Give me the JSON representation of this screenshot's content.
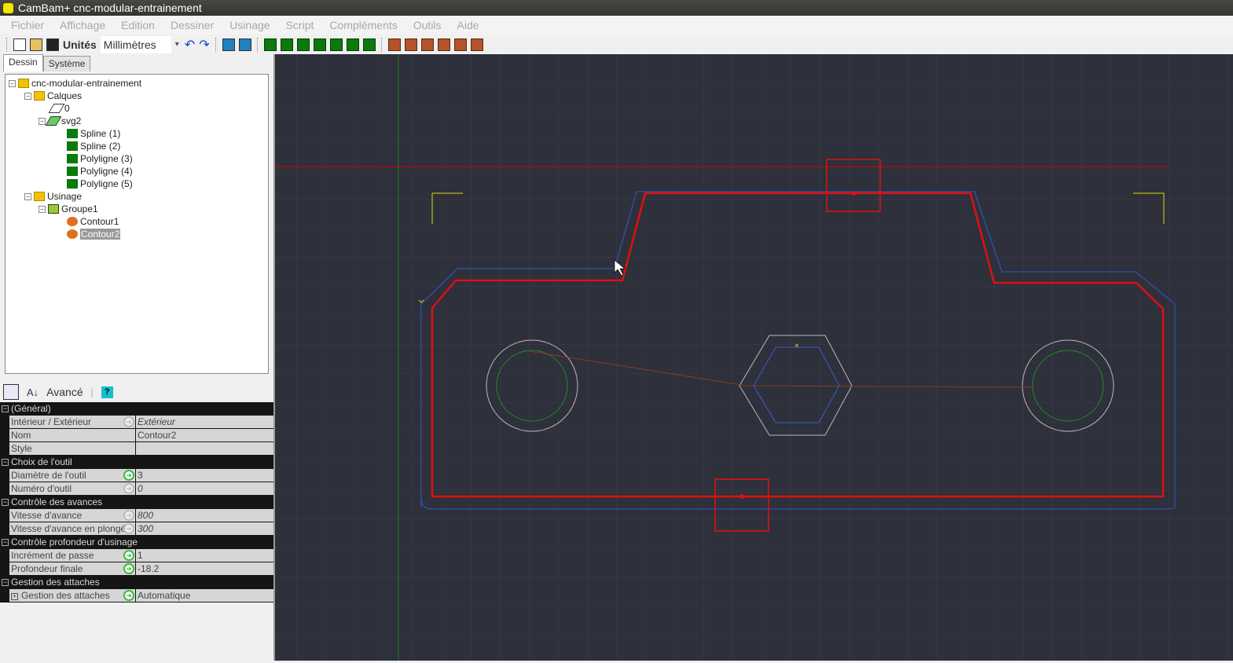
{
  "title": "CamBam+  cnc-modular-entrainement",
  "menu": [
    "Fichier",
    "Affichage",
    "Edition",
    "Dessiner",
    "Usinage",
    "Script",
    "Compléments",
    "Outils",
    "Aide"
  ],
  "toolbar": {
    "units_label": "Unités",
    "units_value": "Millimètres"
  },
  "tabs": [
    "Dessin",
    "Système"
  ],
  "tree": {
    "root": "cnc-modular-entrainement",
    "layers": "Calques",
    "layer0": "0",
    "svg2": "svg2",
    "items": [
      "Spline (1)",
      "Spline (2)",
      "Polyligne (3)",
      "Polyligne (4)",
      "Polyligne (5)"
    ],
    "machining": "Usinage",
    "group": "Groupe1",
    "contour1": "Contour1",
    "contour2": "Contour2"
  },
  "props_toolbar": {
    "advanced": "Avancé",
    "help": "?"
  },
  "props": [
    {
      "cat": "(Général)",
      "rows": [
        {
          "k": "Intérieur / Extérieur",
          "v": "Extérieur",
          "arrow": "off",
          "italic": true
        },
        {
          "k": "Nom",
          "v": "Contour2"
        },
        {
          "k": "Style",
          "v": ""
        }
      ]
    },
    {
      "cat": "Choix de l'outil",
      "rows": [
        {
          "k": "Diamètre de l'outil",
          "v": "3",
          "arrow": "on"
        },
        {
          "k": "Numéro d'outil",
          "v": "0",
          "arrow": "off",
          "italic": true
        }
      ]
    },
    {
      "cat": "Contrôle des avances",
      "rows": [
        {
          "k": "Vitesse d'avance",
          "v": "800",
          "arrow": "off",
          "italic": true
        },
        {
          "k": "Vitesse d'avance en plongée",
          "v": "300",
          "arrow": "off",
          "italic": true
        }
      ]
    },
    {
      "cat": "Contrôle profondeur d'usinage",
      "rows": [
        {
          "k": "Incrément de passe",
          "v": "1",
          "arrow": "on"
        },
        {
          "k": "Profondeur finale",
          "v": "-18.2",
          "arrow": "on"
        }
      ]
    },
    {
      "cat": "Gestion des attaches",
      "rows": [
        {
          "k": "Gestion des attaches",
          "v": "Automatique",
          "arrow": "on",
          "expand": true
        }
      ]
    }
  ]
}
